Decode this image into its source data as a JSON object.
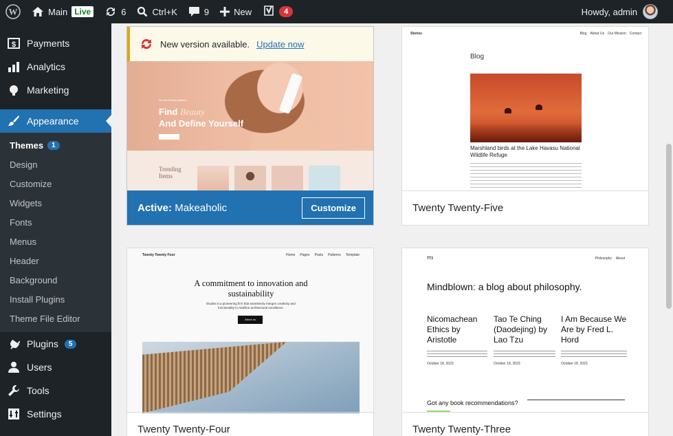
{
  "adminbar": {
    "site_name": "Main",
    "live_label": "Live",
    "updates_count": "6",
    "search_shortcut": "Ctrl+K",
    "comments_count": "9",
    "new_label": "New",
    "yoast_count": "4",
    "howdy": "Howdy, admin"
  },
  "sidebar": {
    "payments": "Payments",
    "analytics": "Analytics",
    "marketing": "Marketing",
    "appearance": "Appearance",
    "submenu": [
      "Themes",
      "Design",
      "Customize",
      "Widgets",
      "Fonts",
      "Menus",
      "Header",
      "Background",
      "Install Plugins",
      "Theme File Editor"
    ],
    "themes_count": "1",
    "plugins": "Plugins",
    "plugins_count": "5",
    "users": "Users",
    "tools": "Tools",
    "settings": "Settings"
  },
  "themes": {
    "notice_text": "New version available.",
    "notice_link": "Update now",
    "active_prefix": "Active:",
    "active_name": "Makeaholic",
    "customize_label": "Customize",
    "t25": "Twenty Twenty-Five",
    "t24": "Twenty Twenty-Four",
    "t23": "Twenty Twenty-Three"
  },
  "previews": {
    "makeaholic": {
      "tagline_1": "Find",
      "tagline_script": "Beauty",
      "tagline_2": "And Define Yourself",
      "small_head": "We Are Beauty Makers",
      "trending": "Trending Items"
    },
    "tt5": {
      "site": "Stories",
      "nav": [
        "Blog",
        "About Us",
        "Our Mission",
        "Contact"
      ],
      "heading": "Blog",
      "caption": "Marshland birds at the Lake Havasu National Wildlife Refuge"
    },
    "tt4": {
      "site": "Twenty Twenty Four",
      "nav": [
        "Home",
        "Pages",
        "Posts",
        "Patterns",
        "Template"
      ],
      "headline": "A commitment to innovation and sustainability",
      "body": "Études is a pioneering firm that seamlessly merges creativity and functionality to redefine architectural excellence.",
      "btn": "About us"
    },
    "tt3": {
      "site": "TT3",
      "nav": [
        "Philosophy",
        "About"
      ],
      "headline": "Mindblown: a blog about philosophy.",
      "posts": [
        "Nicomachean Ethics by Aristotle",
        "Tao Te Ching (Daodejing) by Lao Tzu",
        "I Am Because We Are by Fred L. Hord"
      ],
      "dates": [
        "October 18, 2023",
        "October 18, 2023",
        "October 18, 2023"
      ],
      "question": "Got any book recommendations?"
    }
  }
}
